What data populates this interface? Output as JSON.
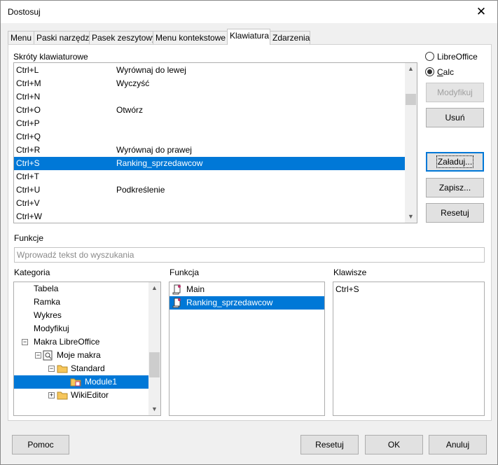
{
  "window": {
    "title": "Dostosuj",
    "close_glyph": "✕"
  },
  "tabs": [
    {
      "label": "Menu"
    },
    {
      "label": "Paski narzędzi"
    },
    {
      "label": "Pasek zeszytowy"
    },
    {
      "label": "Menu kontekstowe"
    },
    {
      "label": "Klawiatura",
      "active": true
    },
    {
      "label": "Zdarzenia"
    }
  ],
  "shortcuts": {
    "label": "Skróty klawiaturowe",
    "rows": [
      {
        "key": "Ctrl+L",
        "func": "Wyrównaj do lewej"
      },
      {
        "key": "Ctrl+M",
        "func": "Wyczyść"
      },
      {
        "key": "Ctrl+N",
        "func": ""
      },
      {
        "key": "Ctrl+O",
        "func": "Otwórz"
      },
      {
        "key": "Ctrl+P",
        "func": ""
      },
      {
        "key": "Ctrl+Q",
        "func": ""
      },
      {
        "key": "Ctrl+R",
        "func": "Wyrównaj do prawej"
      },
      {
        "key": "Ctrl+S",
        "func": "Ranking_sprzedawcow",
        "selected": true
      },
      {
        "key": "Ctrl+T",
        "func": ""
      },
      {
        "key": "Ctrl+U",
        "func": "Podkreślenie"
      },
      {
        "key": "Ctrl+V",
        "func": ""
      },
      {
        "key": "Ctrl+W",
        "func": ""
      }
    ]
  },
  "scope": {
    "libreoffice_label": "LibreOffice",
    "calc_label": "Calc",
    "selected": "calc"
  },
  "side_buttons": {
    "modify": "Modyfikuj",
    "delete": "Usuń",
    "load": "Załaduj...",
    "save": "Zapisz...",
    "reset": "Resetuj"
  },
  "functions": {
    "label": "Funkcje",
    "search_placeholder": "Wprowadź tekst do wyszukania"
  },
  "category": {
    "label": "Kategoria",
    "items": [
      {
        "label": "Tabela",
        "level": 1
      },
      {
        "label": "Ramka",
        "level": 1
      },
      {
        "label": "Wykres",
        "level": 1
      },
      {
        "label": "Modyfikuj",
        "level": 1
      },
      {
        "label": "Makra LibreOffice",
        "level": 1,
        "expander": "⊟"
      },
      {
        "label": "Moje makra",
        "level": 2,
        "expander": "⊟",
        "icon": "macro-library-icon"
      },
      {
        "label": "Standard",
        "level": 3,
        "expander": "⊟",
        "icon": "folder-icon"
      },
      {
        "label": "Module1",
        "level": 4,
        "selected": true,
        "icon": "module-folder-icon"
      },
      {
        "label": "WikiEditor",
        "level": 3,
        "expander": "⊞",
        "icon": "folder-icon"
      }
    ]
  },
  "function_list": {
    "label": "Funkcja",
    "items": [
      {
        "label": "Main",
        "icon": "macro-icon"
      },
      {
        "label": "Ranking_sprzedawcow",
        "icon": "macro-icon",
        "selected": true
      }
    ]
  },
  "keys": {
    "label": "Klawisze",
    "items": [
      "Ctrl+S"
    ]
  },
  "footer": {
    "help": "Pomoc",
    "reset": "Resetuj",
    "ok": "OK",
    "cancel": "Anuluj"
  },
  "colors": {
    "selection": "#0078d7",
    "focus": "#0078d7"
  }
}
